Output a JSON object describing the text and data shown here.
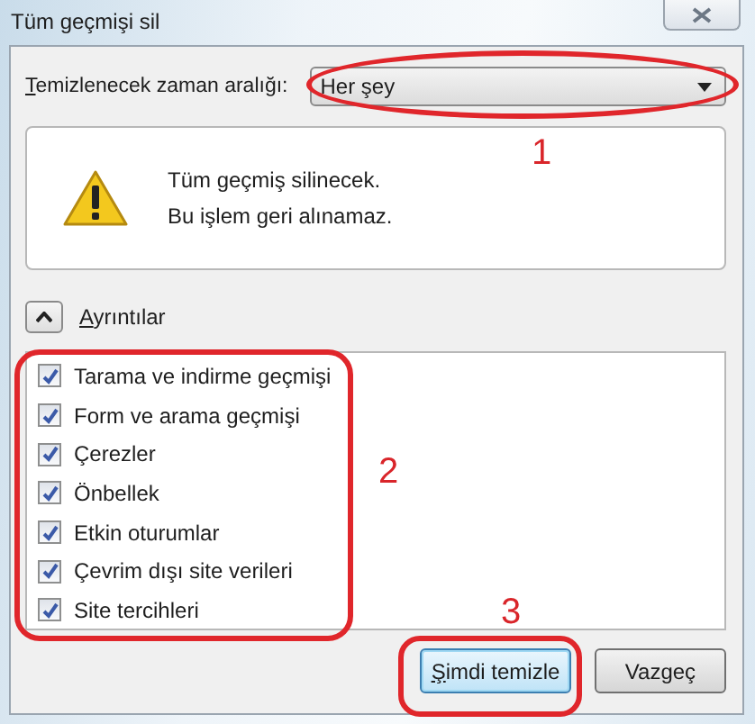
{
  "window": {
    "title": "Tüm geçmişi sil"
  },
  "time_range": {
    "label": "Temizlenecek zaman aralığı:",
    "value": "Her şey"
  },
  "message": {
    "lines": [
      "Tüm geçmiş silinecek.",
      "Bu işlem geri alınamaz."
    ]
  },
  "details": {
    "label": "Ayrıntılar",
    "expanded": true
  },
  "items": [
    {
      "label": "Tarama ve indirme geçmişi",
      "checked": true
    },
    {
      "label": "Form ve arama geçmişi",
      "checked": true
    },
    {
      "label": "Çerezler",
      "checked": true
    },
    {
      "label": "Önbellek",
      "checked": true
    },
    {
      "label": "Etkin oturumlar",
      "checked": true
    },
    {
      "label": "Çevrim dışı site verileri",
      "checked": true
    },
    {
      "label": "Site tercihleri",
      "checked": true
    }
  ],
  "buttons": [
    {
      "label": "Şimdi temizle",
      "default": true
    },
    {
      "label": "Vazgeç",
      "default": false
    }
  ],
  "annotations": [
    {
      "label": "1"
    },
    {
      "label": "2"
    },
    {
      "label": "3"
    }
  ]
}
